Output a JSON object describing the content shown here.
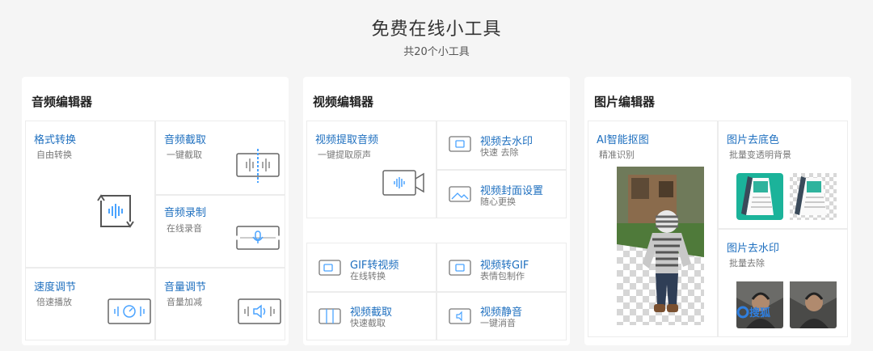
{
  "header": {
    "title": "免费在线小工具",
    "subtitle": "共20个小工具"
  },
  "audio": {
    "title": "音频编辑器",
    "format": {
      "title": "格式转换",
      "desc": "自由转换"
    },
    "cut": {
      "title": "音频截取",
      "desc": "一键截取"
    },
    "record": {
      "title": "音频录制",
      "desc": "在线录音"
    },
    "speed": {
      "title": "速度调节",
      "desc": "倍速播放"
    },
    "volume": {
      "title": "音量调节",
      "desc": "音量加减"
    }
  },
  "video": {
    "title": "视频编辑器",
    "extract": {
      "title": "视频提取音频",
      "desc": "一键提取原声"
    },
    "watermark": {
      "title": "视频去水印",
      "desc": "快速 去除"
    },
    "cover": {
      "title": "视频封面设置",
      "desc": "随心更换"
    },
    "gif2video": {
      "title": "GIF转视频",
      "desc": "在线转换"
    },
    "video2gif": {
      "title": "视频转GIF",
      "desc": "表情包制作"
    },
    "clip": {
      "title": "视频截取",
      "desc": "快速截取"
    },
    "mute": {
      "title": "视频静音",
      "desc": "一键消音"
    }
  },
  "image": {
    "title": "图片编辑器",
    "cutout": {
      "title": "AI智能抠图",
      "desc": "精准识别"
    },
    "bgremove": {
      "title": "图片去底色",
      "desc": "批量变透明背景"
    },
    "wmremove": {
      "title": "图片去水印",
      "desc": "批量去除"
    },
    "watermark_logo_text": "搜狐"
  },
  "colors": {
    "accent": "#1e6fbf",
    "icon_blue": "#4aa3ff",
    "teal": "#1bb39a"
  }
}
